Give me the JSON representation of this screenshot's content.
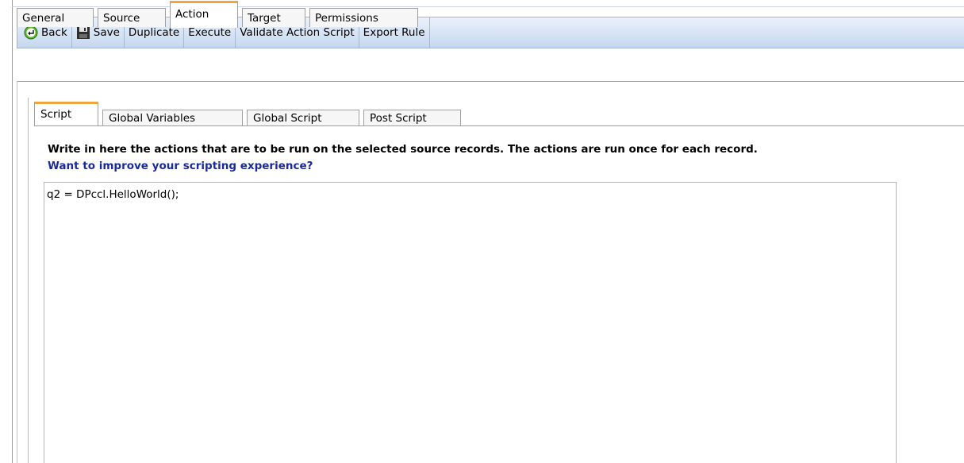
{
  "toolbar": {
    "back": "Back",
    "save": "Save",
    "duplicate": "Duplicate",
    "execute": "Execute",
    "validate": "Validate Action Script",
    "export": "Export Rule"
  },
  "tabs": [
    "General",
    "Source",
    "Action",
    "Target",
    "Permissions"
  ],
  "active_tab": "Action",
  "inner_tabs": [
    "Script",
    "Global Variables",
    "Global Script",
    "Post Script"
  ],
  "active_inner_tab": "Script",
  "description": "Write in here the actions that are to be run on the selected source records. The actions are run once for each record.",
  "improve_link": "Want to improve your scripting experience?",
  "script_text": "q2 = DPccl.HelloWorld();",
  "colors": {
    "toolbar_top": "#eaf1fb",
    "toolbar_bottom": "#c6d7ef",
    "active_tab_accent": "#f0a640",
    "link": "#1a2a9a"
  },
  "icons": {
    "back": "back-arrow-circle-icon",
    "save": "floppy-disk-icon"
  }
}
